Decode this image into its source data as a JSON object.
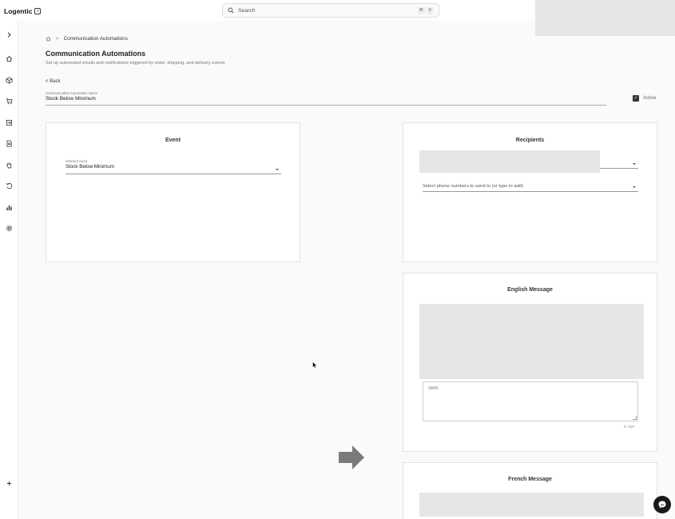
{
  "app": {
    "name": "Logentic"
  },
  "search": {
    "placeholder": "Search",
    "shortcut_mod": "⌘",
    "shortcut_key": "K"
  },
  "sidebar": {
    "items": [
      {
        "name": "expand-icon"
      },
      {
        "name": "home-icon"
      },
      {
        "name": "box-icon"
      },
      {
        "name": "cart-icon"
      },
      {
        "name": "inbound-icon"
      },
      {
        "name": "document-icon"
      },
      {
        "name": "hand-icon"
      },
      {
        "name": "returns-icon"
      },
      {
        "name": "chart-icon"
      },
      {
        "name": "settings-icon"
      },
      {
        "name": "plus-icon"
      }
    ]
  },
  "breadcrumb": {
    "separator": ">",
    "current": "Communication Automations"
  },
  "page": {
    "title": "Communication Automations",
    "subtitle": "Set up automated emails and notifications triggered by order, shipping, and delivery events",
    "back_label": "< Back"
  },
  "automation": {
    "name_label": "Communication Automation Name",
    "name_value": "Stock Below Minimum",
    "active_label": "Active",
    "active_checked": true
  },
  "event_card": {
    "title": "Event",
    "select_label": "Selected event",
    "select_value": "Stock Below Minimum"
  },
  "recipients_card": {
    "title": "Recipients",
    "phone_placeholder": "Select phone numbers to send to (or type to add)"
  },
  "english_card": {
    "title": "English Message",
    "sms_placeholder": "SMS",
    "char_count": "0 / 320"
  },
  "french_card": {
    "title": "French Message"
  },
  "colors": {
    "accent": "#333333",
    "placeholder_gray": "#e6e6e6",
    "arrow": "#7a7a7a"
  }
}
